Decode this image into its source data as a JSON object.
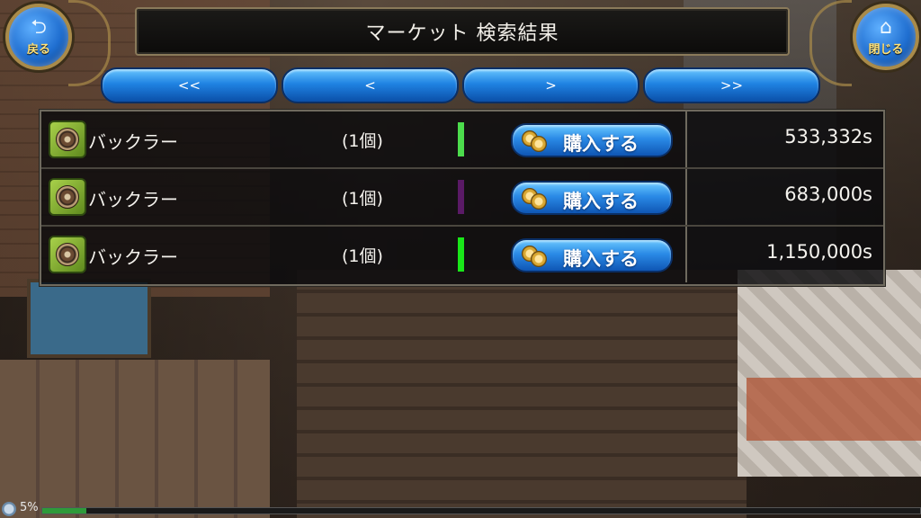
{
  "header": {
    "title": "マーケット 検索結果",
    "back_label": "戻る",
    "close_label": "閉じる"
  },
  "pagination": {
    "first": "<<",
    "prev": "<",
    "next": ">",
    "last": ">>"
  },
  "results": [
    {
      "name": "バックラー",
      "quantity": "(1個)",
      "rarity_color": "#4cdc4c",
      "buy_label": "購入する",
      "price": "533,332s"
    },
    {
      "name": "バックラー",
      "quantity": "(1個)",
      "rarity_color": "#5a1a66",
      "buy_label": "購入する",
      "price": "683,000s"
    },
    {
      "name": "バックラー",
      "quantity": "(1個)",
      "rarity_color": "#19e619",
      "buy_label": "購入する",
      "price": "1,150,000s"
    }
  ],
  "status": {
    "percent_text": "5%",
    "progress_fraction": 0.05
  }
}
